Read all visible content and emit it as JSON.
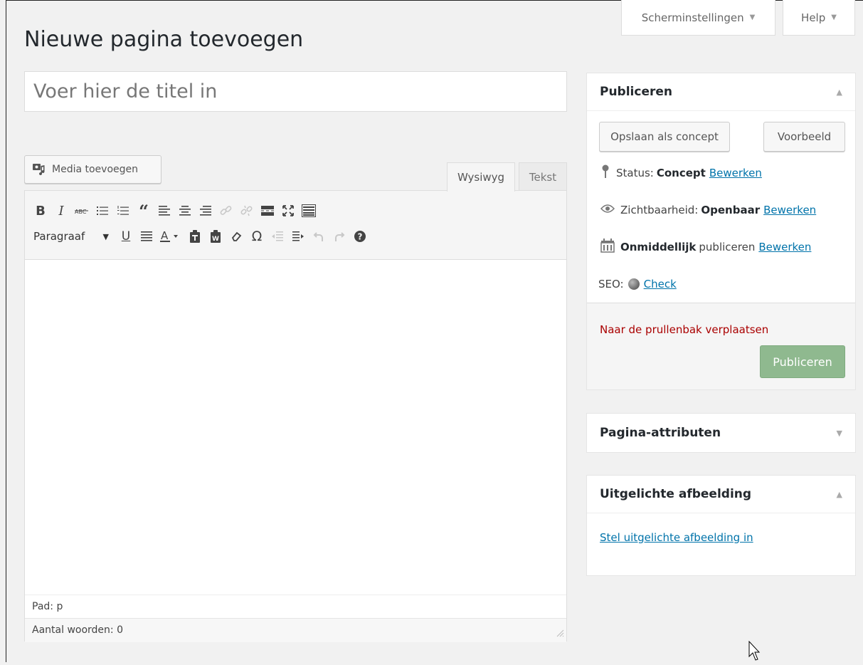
{
  "screen_options": {
    "screen_label": "Scherminstellingen",
    "help_label": "Help"
  },
  "page": {
    "title": "Nieuwe pagina toevoegen"
  },
  "post_title": {
    "placeholder": "Voer hier de titel in"
  },
  "media": {
    "label": "Media toevoegen"
  },
  "editor": {
    "tab_visual": "Wysiwyg",
    "tab_text": "Tekst",
    "format_select": "Paragraaf",
    "path": "Pad: p",
    "word_count": "Aantal woorden: 0"
  },
  "publish_box": {
    "title": "Publiceren",
    "save_draft": "Opslaan als concept",
    "preview": "Voorbeeld",
    "status_label": "Status:",
    "status_value": "Concept",
    "visibility_label": "Zichtbaarheid:",
    "visibility_value": "Openbaar",
    "schedule_value": "Onmiddellijk",
    "schedule_suffix": "publiceren",
    "edit_link": "Bewerken",
    "seo_label": "SEO:",
    "seo_link": "Check",
    "trash": "Naar de prullenbak verplaatsen",
    "publish": "Publiceren"
  },
  "attributes_box": {
    "title": "Pagina-attributen"
  },
  "featured_box": {
    "title": "Uitgelichte afbeelding",
    "link": "Stel uitgelichte afbeelding in"
  },
  "colors": {
    "link": "#0073aa",
    "trash": "#aa0000",
    "publish_button": "#8fb98f",
    "background": "#f1f1f1"
  }
}
